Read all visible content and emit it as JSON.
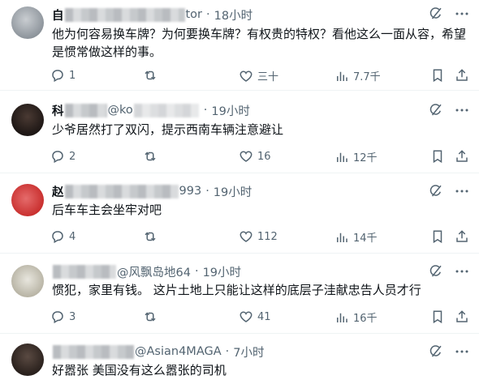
{
  "tweets": [
    {
      "name_visible": "自",
      "handle_visible": "tor",
      "time": "18小时",
      "text": "他为何容易换车牌？为何要换车牌？有权贵的特权？看他这么一面从容，希望是惯常做这样的事。",
      "replies": "1",
      "retweets": "",
      "likes": "三十",
      "views": "7.7千"
    },
    {
      "name_visible": "科",
      "handle_visible": "@ko",
      "time": "19小时",
      "text": "少爷居然打了双闪，提示西南车辆注意避让",
      "replies": "2",
      "retweets": "",
      "likes": "16",
      "views": "12千"
    },
    {
      "name_visible": "赵",
      "handle_visible": "993",
      "time": "19小时",
      "text": "后车车主会坐牢对吧",
      "replies": "4",
      "retweets": "",
      "likes": "112",
      "views": "14千"
    },
    {
      "name_visible": "",
      "handle_visible": "@风飘岛地64",
      "time": "19小时",
      "text": "惯犯，家里有钱。 这片土地上只能让这样的底层子洼献忠告人员才行",
      "replies": "3",
      "retweets": "",
      "likes": "41",
      "views": "16千"
    },
    {
      "name_visible": "",
      "handle_visible": "@Asian4MAGA",
      "time": "7小时",
      "text": "好嚣张 美国没有这么嚣张的司机"
    }
  ],
  "separator": "·",
  "colors": {
    "text": "#0f1419",
    "muted": "#536471",
    "border": "#eff3f4"
  }
}
